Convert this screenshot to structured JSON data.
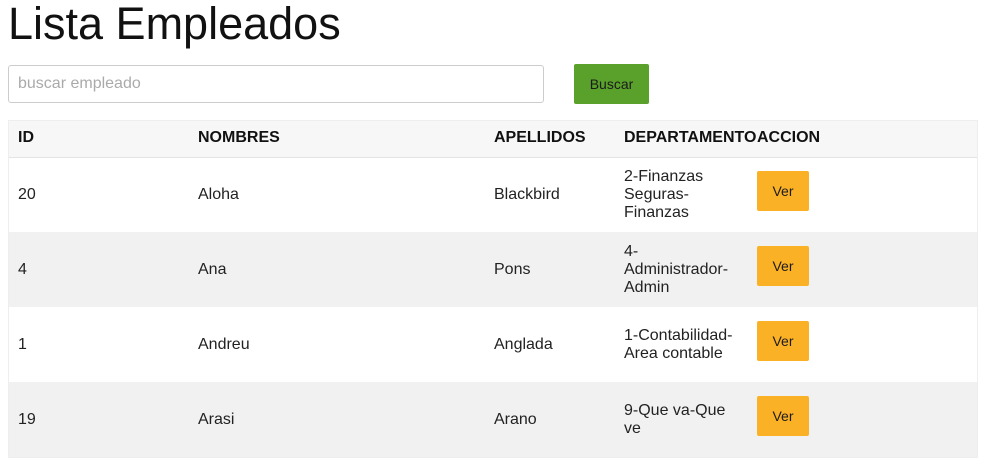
{
  "page": {
    "title": "Lista Empleados"
  },
  "search": {
    "placeholder": "buscar empleado",
    "value": "",
    "button_label": "Buscar"
  },
  "table": {
    "headers": {
      "id": "ID",
      "nombres": "NOMBRES",
      "apellidos": "APELLIDOS",
      "departamento": "DEPARTAMENTO",
      "accion": "ACCION"
    },
    "rows": [
      {
        "id": "20",
        "nombres": "Aloha",
        "apellidos": "Blackbird",
        "departamento": "2-Finanzas Seguras-Finanzas",
        "accion": "Ver"
      },
      {
        "id": "4",
        "nombres": "Ana",
        "apellidos": "Pons",
        "departamento": "4-Administrador-Admin",
        "accion": "Ver"
      },
      {
        "id": "1",
        "nombres": "Andreu",
        "apellidos": "Anglada",
        "departamento": "1-Contabilidad-Area contable",
        "accion": "Ver"
      },
      {
        "id": "19",
        "nombres": "Arasi",
        "apellidos": "Arano",
        "departamento": "9-Que va-Que ve",
        "accion": "Ver"
      }
    ]
  },
  "colors": {
    "search_button": "#5aa12b",
    "ver_button": "#fbb126",
    "header_bg": "#f7f7f7",
    "stripe_bg": "#f1f1f1"
  }
}
